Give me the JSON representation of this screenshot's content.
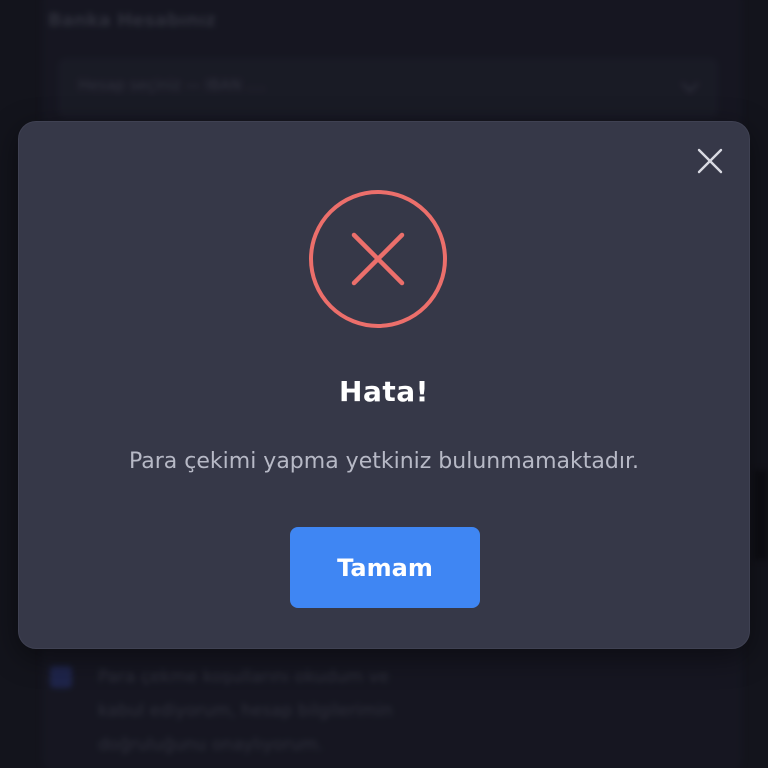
{
  "background": {
    "heading": "Banka Hesabınız",
    "select_value": "Hesap seçiniz — IBAN ....",
    "terms_lines": [
      "Para çekme koşullarını okudum ve",
      "kabul ediyorum, hesap bilgilerimin",
      "doğruluğunu onaylıyorum."
    ]
  },
  "modal": {
    "icon": "error-x-circle-icon",
    "title": "Hata!",
    "message": "Para çekimi yapma yetkiniz bulunmamaktadır.",
    "ok_label": "Tamam",
    "close_icon": "close-icon"
  },
  "colors": {
    "modal_background": "#363848",
    "error_red": "#ec6f6b",
    "button_blue": "#3f86f3",
    "close_icon": "#d9dae2",
    "page_background": "#1b1c27"
  }
}
